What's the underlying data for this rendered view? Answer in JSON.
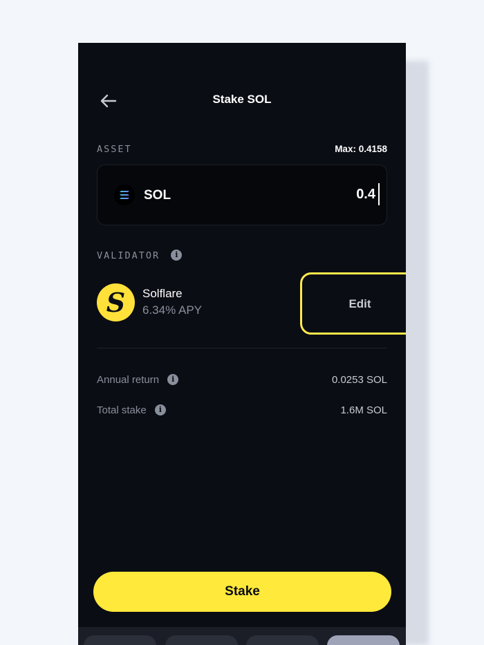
{
  "header": {
    "title": "Stake SOL",
    "back_icon": "arrow-left-icon"
  },
  "asset": {
    "section_label": "ASSET",
    "max_label": "Max: 0.4158",
    "token_name": "SOL",
    "amount_value": "0.4"
  },
  "validator": {
    "section_label": "VALIDATOR",
    "name": "Solflare",
    "apy": "6.34% APY",
    "edit_label": "Edit"
  },
  "stats": {
    "annual_return_label": "Annual return",
    "annual_return_value": "0.0253 SOL",
    "total_stake_label": "Total stake",
    "total_stake_value": "1.6M SOL"
  },
  "actions": {
    "stake_label": "Stake"
  },
  "colors": {
    "background": "#0b0d14",
    "accent": "#ffe93a",
    "highlight_outline": "#ffe94d",
    "muted_text": "#8a8f9c"
  }
}
